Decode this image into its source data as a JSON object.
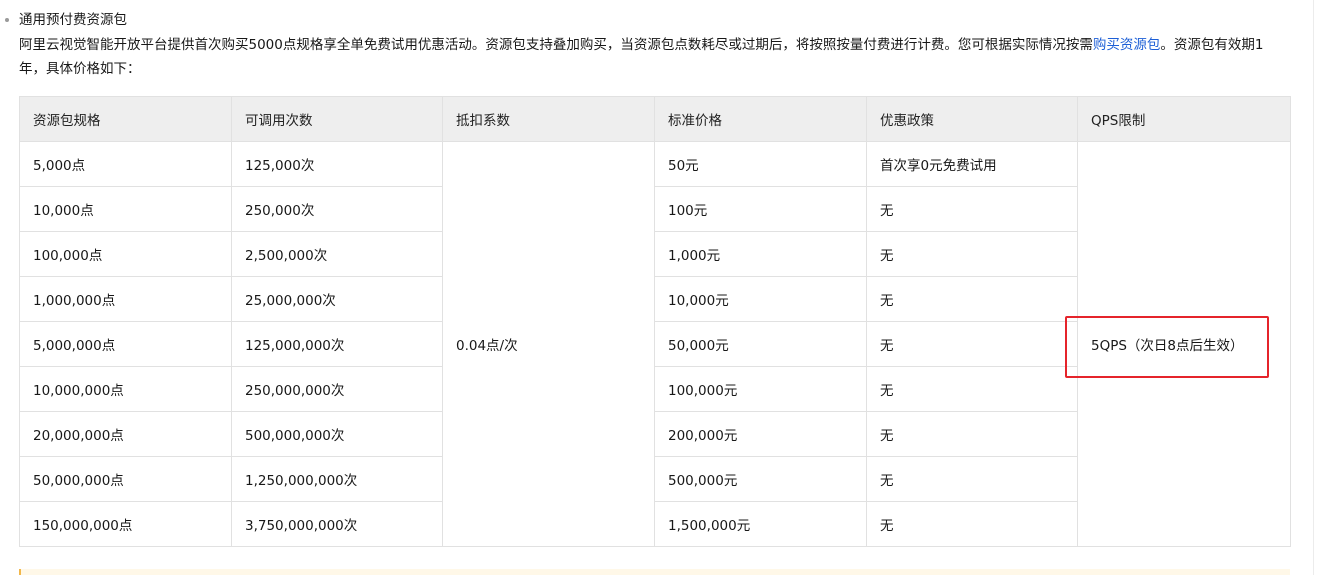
{
  "section": {
    "title": "通用预付费资源包",
    "intro_before_link": "阿里云视觉智能开放平台提供首次购买5000点规格享全单免费试用优惠活动。资源包支持叠加购买，当资源包点数耗尽或过期后，将按照按量付费进行计费。您可根据实际情况按需",
    "intro_link": "购买资源包",
    "intro_after_link": "。资源包有效期1年，具体价格如下："
  },
  "table": {
    "headers": [
      "资源包规格",
      "可调用次数",
      "抵扣系数",
      "标准价格",
      "优惠政策",
      "QPS限制"
    ],
    "deduction_coefficient": "0.04点/次",
    "qps_limit": "5QPS（次日8点后生效）",
    "rows": [
      {
        "spec": "5,000点",
        "calls": "125,000次",
        "price": "50元",
        "policy": "首次享0元免费试用"
      },
      {
        "spec": "10,000点",
        "calls": "250,000次",
        "price": "100元",
        "policy": "无"
      },
      {
        "spec": "100,000点",
        "calls": "2,500,000次",
        "price": "1,000元",
        "policy": "无"
      },
      {
        "spec": "1,000,000点",
        "calls": "25,000,000次",
        "price": "10,000元",
        "policy": "无"
      },
      {
        "spec": "5,000,000点",
        "calls": "125,000,000次",
        "price": "50,000元",
        "policy": "无"
      },
      {
        "spec": "10,000,000点",
        "calls": "250,000,000次",
        "price": "100,000元",
        "policy": "无"
      },
      {
        "spec": "20,000,000点",
        "calls": "500,000,000次",
        "price": "200,000元",
        "policy": "无"
      },
      {
        "spec": "50,000,000点",
        "calls": "1,250,000,000次",
        "price": "500,000元",
        "policy": "无"
      },
      {
        "spec": "150,000,000点",
        "calls": "3,750,000,000次",
        "price": "1,500,000元",
        "policy": "无"
      }
    ]
  },
  "colors": {
    "link": "#1d5fd6",
    "highlight_box": "#e5242b",
    "header_background": "#eeeeee",
    "note_accent": "#f2b74a"
  }
}
